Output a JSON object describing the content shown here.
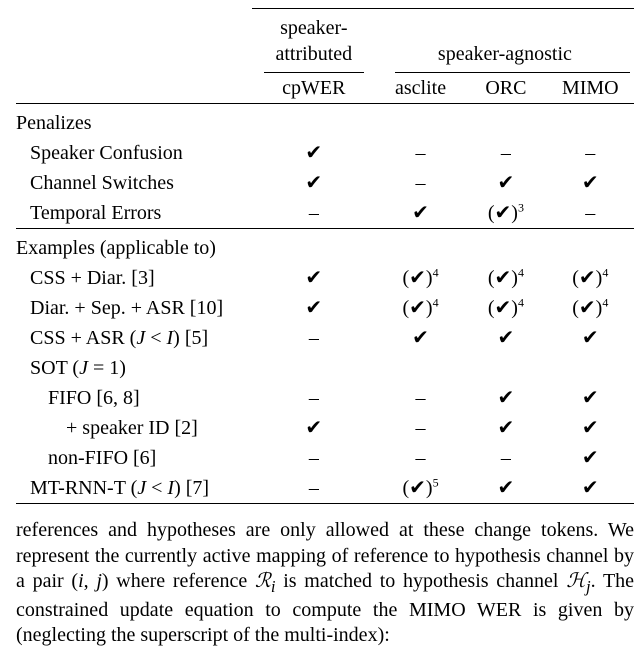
{
  "header": {
    "group_sa": "speaker-attributed",
    "group_ag": "speaker-agnostic",
    "col_cp": "cpWER",
    "col_asc": "asclite",
    "col_orc": "ORC",
    "col_mimo": "MIMO"
  },
  "sections": {
    "penalizes": "Penalizes",
    "examples": "Examples (applicable to)"
  },
  "rows": {
    "penalizes": [
      {
        "label": "Speaker Confusion",
        "cp": "✔",
        "asc": "–",
        "orc": "–",
        "mimo": "–"
      },
      {
        "label": "Channel Switches",
        "cp": "✔",
        "asc": "–",
        "orc": "✔",
        "mimo": "✔"
      },
      {
        "label": "Temporal Errors",
        "cp": "–",
        "asc": "✔",
        "orc": "(✔)",
        "orc_sup": "3",
        "mimo": "–"
      }
    ],
    "examples": [
      {
        "label": "CSS + Diar. [3]",
        "indent": 1,
        "cp": "✔",
        "asc": "(✔)",
        "asc_sup": "4",
        "orc": "(✔)",
        "orc_sup": "4",
        "mimo": "(✔)",
        "mimo_sup": "4"
      },
      {
        "label": "Diar. + Sep. + ASR [10]",
        "indent": 1,
        "cp": "✔",
        "asc": "(✔)",
        "asc_sup": "4",
        "orc": "(✔)",
        "orc_sup": "4",
        "mimo": "(✔)",
        "mimo_sup": "4"
      },
      {
        "label": "CSS + ASR (J < I) [5]",
        "indent": 1,
        "cp": "–",
        "asc": "✔",
        "orc": "✔",
        "mimo": "✔",
        "ji": true
      },
      {
        "label": "SOT (J = 1)",
        "indent": 1,
        "cp": "",
        "asc": "",
        "orc": "",
        "mimo": "",
        "j1": true
      },
      {
        "label": "FIFO [6, 8]",
        "indent": 2,
        "cp": "–",
        "asc": "–",
        "orc": "✔",
        "mimo": "✔"
      },
      {
        "label": "+ speaker ID [2]",
        "indent": 3,
        "cp": "✔",
        "asc": "–",
        "orc": "✔",
        "mimo": "✔"
      },
      {
        "label": "non-FIFO [6]",
        "indent": 2,
        "cp": "–",
        "asc": "–",
        "orc": "–",
        "mimo": "✔"
      },
      {
        "label": "MT-RNN-T (J < I) [7]",
        "indent": 1,
        "cp": "–",
        "asc": "(✔)",
        "asc_sup": "5",
        "orc": "✔",
        "mimo": "✔",
        "ji": true
      }
    ]
  },
  "paragraph": {
    "line1_a": "references and hypotheses are only allowed at these change tokens.",
    "line2_a": "We represent the currently active mapping of reference to hypothesis",
    "line3_a": "channel by a pair ",
    "pair": "(i, j)",
    "line3_b": " where reference ",
    "Ri": "ℛ",
    "Ri_sub": "i",
    "line3_c": " is matched to hypothesis",
    "line4_a": "channel ",
    "Hj": "ℋ",
    "Hj_sub": "j",
    "line4_b": ". The constrained update equation to compute the MIMO",
    "line5_a": "WER is given by (neglecting the superscript of the multi-index):"
  }
}
